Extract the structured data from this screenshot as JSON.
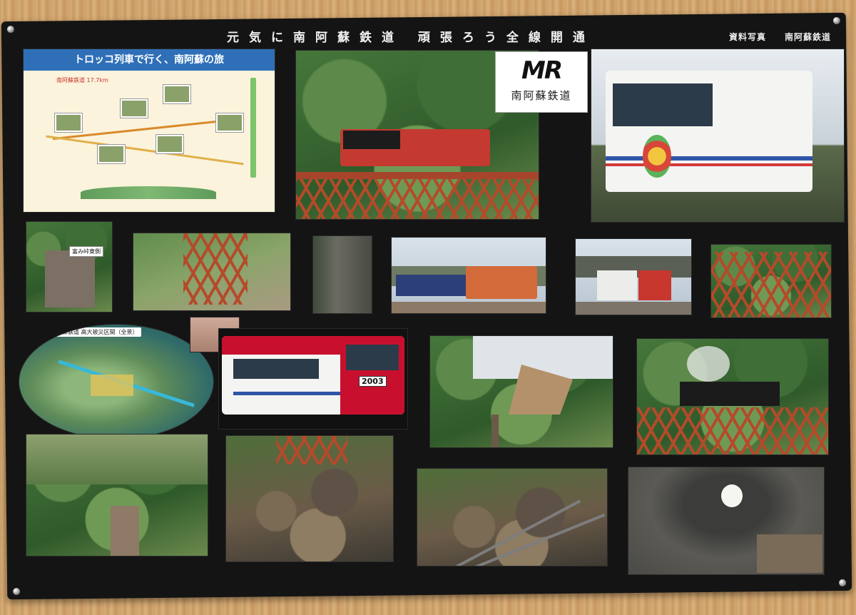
{
  "board": {
    "title": "元気に南阿蘇鉄道 頑張ろう全線開通",
    "credit_source": "資料写真",
    "credit_company": "南阿蘇鉄道"
  },
  "map_panel": {
    "header": "トロッコ列車で行く、南阿蘇の旅",
    "distance": "南阿蘇鉄道 17.7km"
  },
  "logo": {
    "mark": "MR",
    "name": "南阿蘇鉄道"
  },
  "photo_labels": {
    "small_sign": "富み峠東側",
    "oval_map_title": "南阿蘇鉄道 高大被災区間（全景）",
    "car_number": "2003"
  },
  "colors": {
    "board": "#141414",
    "wood": "#d2a670",
    "map_header": "#2f6fb8",
    "train_red": "#c7372d",
    "bridge_red": "#b44a2a"
  }
}
